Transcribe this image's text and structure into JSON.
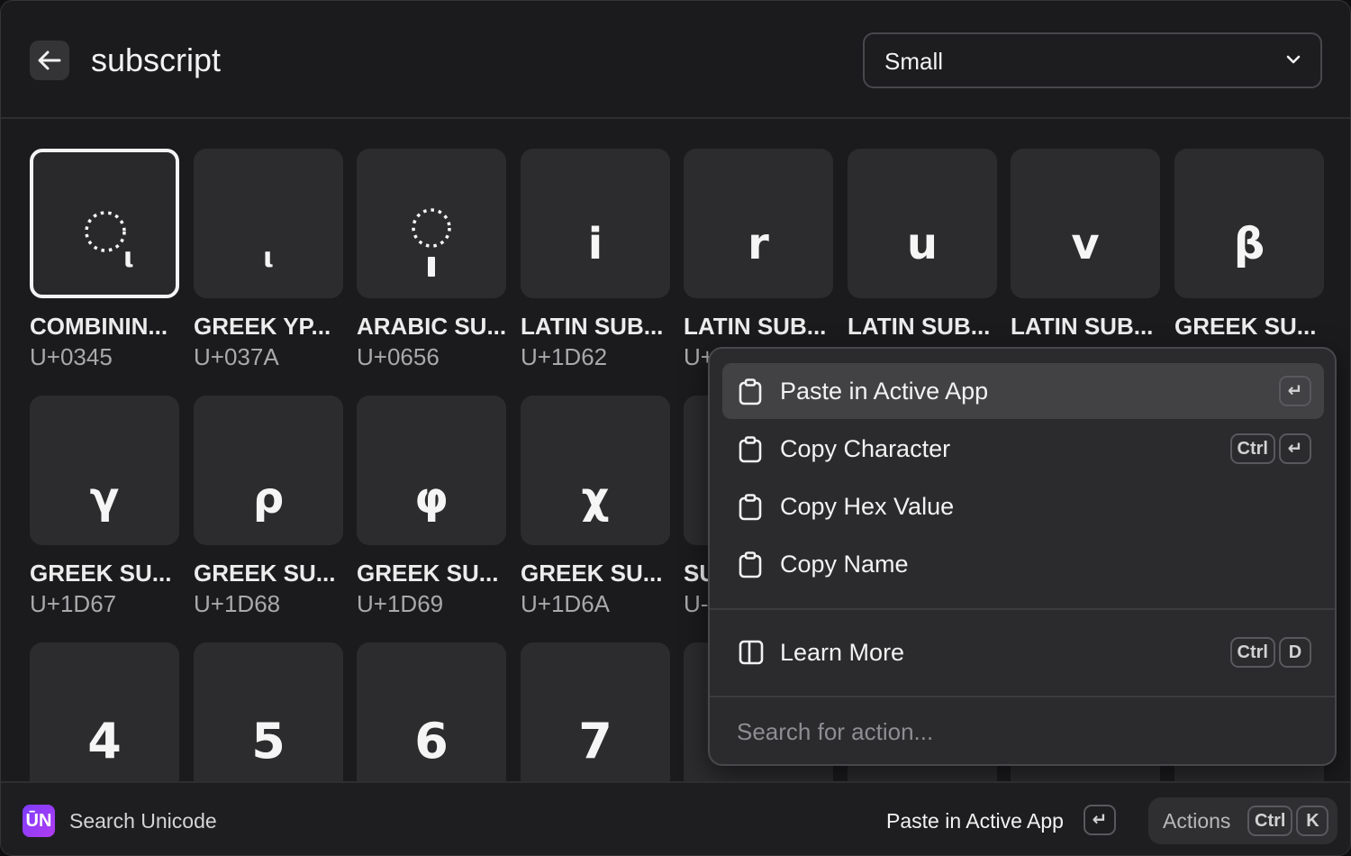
{
  "header": {
    "search_query": "subscript",
    "dropdown_value": "Small"
  },
  "grid": {
    "rows": [
      [
        {
          "glyph": "◌ͅ",
          "name": "COMBININ...",
          "code": "U+0345",
          "selected": true
        },
        {
          "glyph": "ͺ",
          "name": "GREEK YP...",
          "code": "U+037A"
        },
        {
          "glyph": "◌ٖ",
          "name": "ARABIC SU...",
          "code": "U+0656"
        },
        {
          "glyph": "ᵢ",
          "name": "LATIN SUB...",
          "code": "U+1D62"
        },
        {
          "glyph": "ᵣ",
          "name": "LATIN SUB...",
          "code": "U+"
        },
        {
          "glyph": "ᵤ",
          "name": "LATIN SUB..."
        },
        {
          "glyph": "ᵥ",
          "name": "LATIN SUB..."
        },
        {
          "glyph": "ᵦ",
          "name": "GREEK SU..."
        }
      ],
      [
        {
          "glyph": "ᵧ",
          "name": "GREEK SU...",
          "code": "U+1D67"
        },
        {
          "glyph": "ᵨ",
          "name": "GREEK SU...",
          "code": "U+1D68"
        },
        {
          "glyph": "ᵩ",
          "name": "GREEK SU...",
          "code": "U+1D69"
        },
        {
          "glyph": "ᵪ",
          "name": "GREEK SU...",
          "code": "U+1D6A"
        },
        {
          "glyph": "",
          "name": "SU",
          "code": "U-"
        }
      ],
      [
        {
          "glyph": "4"
        },
        {
          "glyph": "5"
        },
        {
          "glyph": "6"
        },
        {
          "glyph": "7"
        },
        {
          "glyph": ""
        }
      ]
    ]
  },
  "actions_panel": {
    "items": [
      {
        "label": "Paste in Active App",
        "icon": "clipboard-icon",
        "keys": [
          "↵"
        ],
        "active": true
      },
      {
        "label": "Copy Character",
        "icon": "clipboard-icon",
        "keys": [
          "Ctrl",
          "↵"
        ]
      },
      {
        "label": "Copy Hex Value",
        "icon": "clipboard-icon",
        "keys": []
      },
      {
        "label": "Copy Name",
        "icon": "clipboard-icon",
        "keys": []
      },
      {
        "label": "Learn More",
        "icon": "sidebar-panel-icon",
        "keys": [
          "Ctrl",
          "D"
        ]
      }
    ],
    "search_placeholder": "Search for action..."
  },
  "footer": {
    "app_logo": "Ū̄N",
    "title": "Search Unicode",
    "primary_action": "Paste in Active App",
    "primary_key": "↵",
    "actions_label": "Actions",
    "actions_keys": [
      "Ctrl",
      "K"
    ]
  },
  "colors": {
    "window_bg": "#1b1b1d",
    "tile_bg": "#2c2c2e",
    "panel_bg": "#2b2b2d",
    "active_item_bg": "#424245",
    "logo_gradient_start": "#7d3cff",
    "logo_gradient_end": "#b03cf0"
  }
}
